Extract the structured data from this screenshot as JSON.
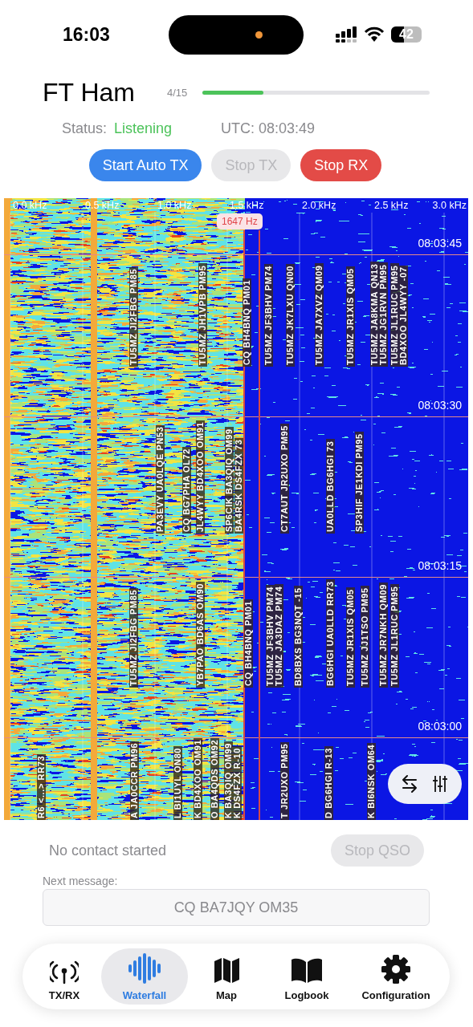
{
  "status_bar": {
    "time": "16:03",
    "battery": "42"
  },
  "header": {
    "title": "FT Ham",
    "cycle": "4/15",
    "cycle_progress": {
      "level": 0.27
    },
    "status_label": "Status:",
    "status_value": "Listening",
    "utc": "UTC: 08:03:49"
  },
  "buttons": [
    {
      "label": "Start Auto TX",
      "kind": "primary",
      "disabled": false
    },
    {
      "label": "Stop TX",
      "kind": "primary",
      "disabled": true
    },
    {
      "label": "Stop RX",
      "kind": "destructive",
      "disabled": false
    }
  ],
  "waterfall": {
    "frequency_labels": [
      "0.0 kHz",
      "0.5 kHz",
      "1.0 kHz",
      "1.5 kHz",
      "2.0 kHz",
      "2.5 kHz",
      "3.0 kHz"
    ],
    "time_labels": [
      "08:03:45",
      "08:03:30",
      "08:03:15",
      "08:03:00"
    ],
    "cursor_readout": "1647 Hz",
    "decodes": [
      {
        "text": "TU5MZ JI2FBG PM85"
      },
      {
        "text": "TU5MZ JH1VPB PM95"
      },
      {
        "text": "CQ BH4BNQ PM01"
      },
      {
        "text": "TU5MZ JF3BHV PM74"
      },
      {
        "text": "TU5MZ JK7LXU QN00"
      },
      {
        "text": "TU5MZ JA7XVZ QM09"
      },
      {
        "text": "TU5MZ JR1XIS QM05"
      },
      {
        "text": "TU5MZ JA8KMA QN13"
      },
      {
        "text": "TU5MZ JG1RVN PM95"
      },
      {
        "text": "TU5MZ JL1RUC PM95"
      },
      {
        "text": "BD4XOO JL4WYY -07"
      },
      {
        "text": "PA3EVY UA0LQE PN53"
      },
      {
        "text": "CQ BG7PHA OL72"
      },
      {
        "text": "JL4WYY BD4XOO OM91"
      },
      {
        "text": "SP6CIK BA3QIQ OM99"
      },
      {
        "text": "BA4RSK DS4FZX 73"
      },
      {
        "text": "CT7AUT JR2UXO PM95"
      },
      {
        "text": "UA0LLD BG6HGI 73"
      },
      {
        "text": "SP3HIF JE1KDI PM95"
      },
      {
        "text": "TU5MZ JI2FBG PM85"
      },
      {
        "text": "YB7PAO BD6AS OM90"
      },
      {
        "text": "CQ BH4BNQ PM01"
      },
      {
        "text": "TU5MZ JF3BHV PM74"
      },
      {
        "text": "TU5MZ JA3DAZ PM74"
      },
      {
        "text": "BD8BXS BG3NQT -15"
      },
      {
        "text": "BG6HGI UA0LLD RR73"
      },
      {
        "text": "TU5MZ JR1XIS QM05"
      },
      {
        "text": "TU5MZ JJ1TSO PM95"
      },
      {
        "text": "TU5MZ JR7NKH QM09"
      },
      {
        "text": "TU5MZ JL1RUC PM95"
      },
      {
        "text": "R6 <...> RR73"
      },
      {
        "text": "A JA0CCR PM96"
      },
      {
        "text": "L BI1UYL ON80"
      },
      {
        "text": "K BD4XOO OM91"
      },
      {
        "text": "O BA4QDS OM92"
      },
      {
        "text": "K BA3QIQ OM99"
      },
      {
        "text": "K DS4FZX R-10"
      },
      {
        "text": "T JR2UXO PM95"
      },
      {
        "text": "D BG6HGI R-13"
      },
      {
        "text": "K BI6NSK OM64"
      }
    ]
  },
  "qso": {
    "status": "No contact started",
    "stop_button": {
      "label": "Stop QSO",
      "disabled": true
    },
    "next_message_label": "Next message:",
    "next_message": "CQ BA7JQY OM35"
  },
  "tabs": [
    {
      "label": "TX/RX",
      "selected": false
    },
    {
      "label": "Waterfall",
      "selected": true
    },
    {
      "label": "Map",
      "selected": false
    },
    {
      "label": "Logbook",
      "selected": false
    },
    {
      "label": "Configuration",
      "selected": false
    }
  ]
}
